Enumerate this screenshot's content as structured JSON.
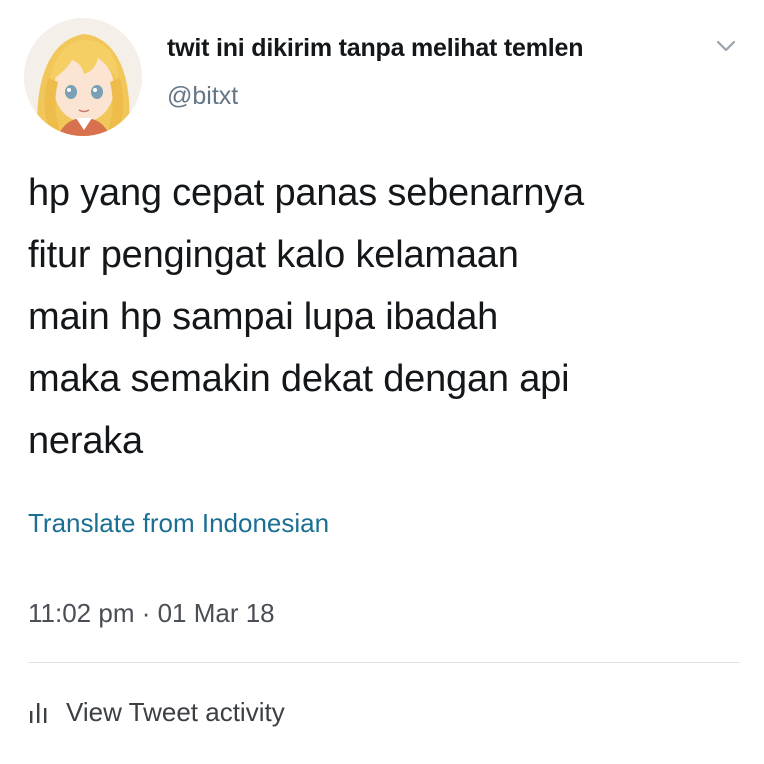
{
  "tweet": {
    "display_name": "twit ini dikirim tanpa melihat temlen",
    "handle": "@bitxt",
    "text_lines": [
      "hp yang cepat panas sebenarnya",
      "fitur pengingat kalo kelamaan",
      "main hp sampai lupa ibadah",
      "maka semakin dekat dengan api",
      "neraka"
    ],
    "translate_label": "Translate from Indonesian",
    "timestamp": "11:02 pm · 01 Mar 18",
    "activity_label": "View Tweet activity"
  },
  "icons": {
    "avatar": "anime-avatar",
    "menu": "chevron-down-icon",
    "activity": "bar-chart-icon"
  },
  "colors": {
    "link": "#1b6f93",
    "secondary_text": "#657786",
    "primary_text": "#14171a"
  }
}
